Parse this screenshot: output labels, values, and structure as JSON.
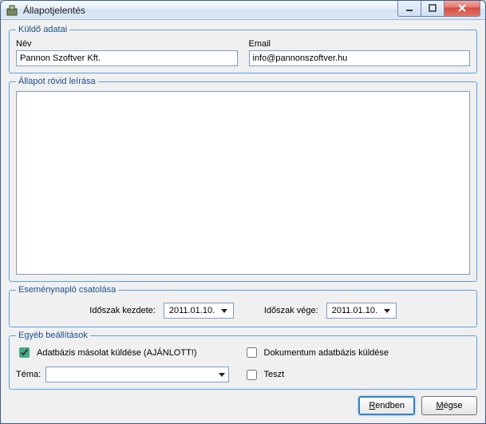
{
  "window": {
    "title": "Állapotjelentés"
  },
  "sender": {
    "legend": "Küldő adatai",
    "name_label": "Név",
    "name_value": "Pannon Szoftver Kft.",
    "email_label": "Email",
    "email_value": "info@pannonszoftver.hu"
  },
  "description": {
    "legend": "Állapot rövid leírása",
    "value": ""
  },
  "eventlog": {
    "legend": "Eseménynapló csatolása",
    "period_start_label": "Időszak kezdete:",
    "period_start_value": "2011.01.10.",
    "period_end_label": "Időszak vége:",
    "period_end_value": "2011.01.10."
  },
  "options": {
    "legend": "Egyéb beállítások",
    "db_copy_label": "Adatbázis másolat küldése (AJÁNLOTT!)",
    "db_copy_checked": true,
    "doc_db_label": "Dokumentum adatbázis küldése",
    "doc_db_checked": false,
    "theme_label": "Téma:",
    "theme_value": "",
    "test_label": "Teszt",
    "test_checked": false
  },
  "buttons": {
    "ok_prefix": "R",
    "ok_suffix": "endben",
    "cancel_prefix": "M",
    "cancel_suffix": "égse"
  }
}
